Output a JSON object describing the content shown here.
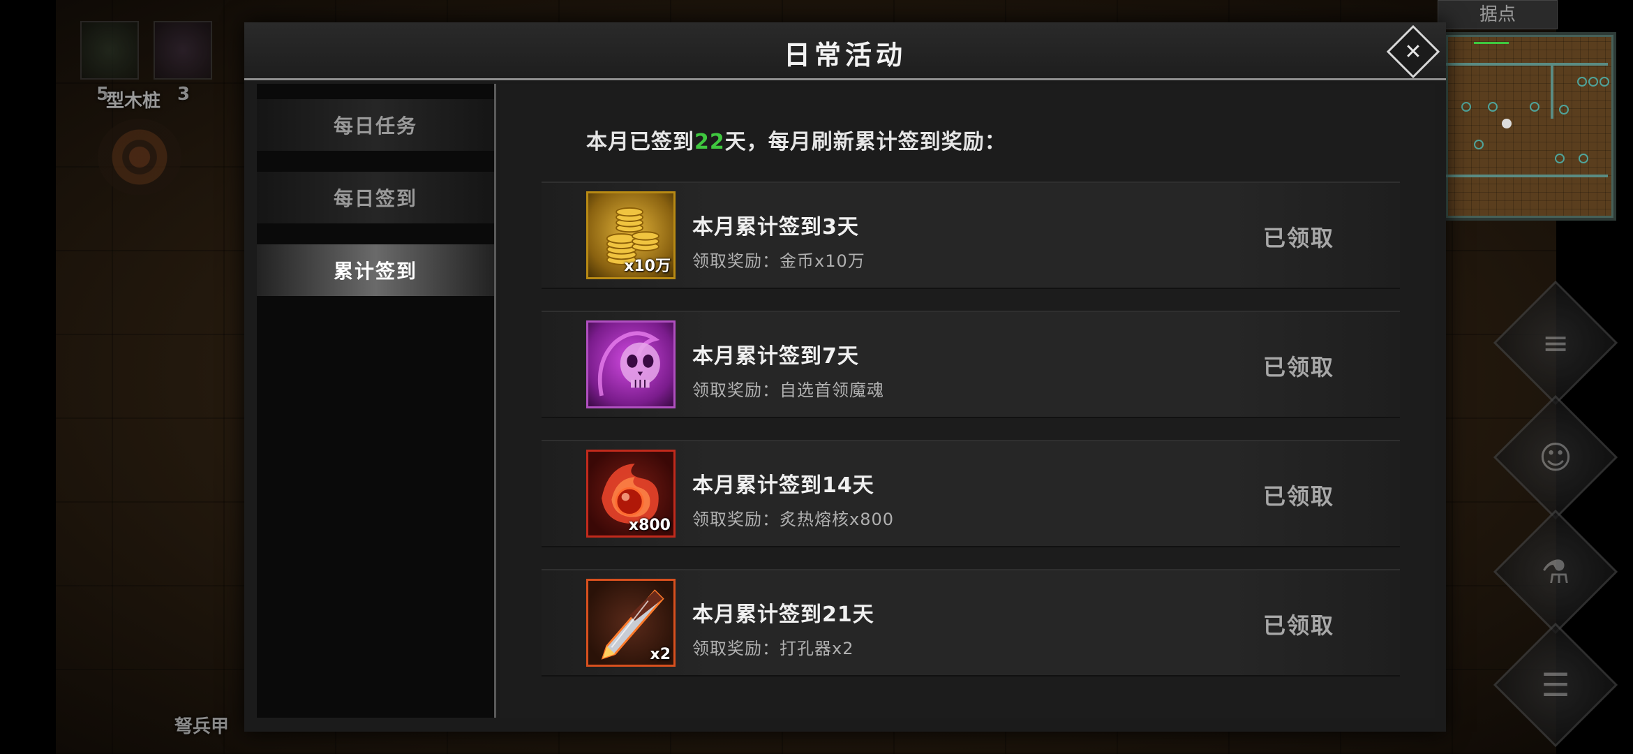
{
  "background": {
    "training_dummy_label": "型木桩",
    "dummy_prefix_numbers": "5",
    "dummy_suffix_number": "3",
    "crossbow_label": "弩兵甲",
    "minimap_title": "据点",
    "side_buttons": [
      "quest-scroll-icon",
      "friends-icon",
      "potion-icon",
      "menu-list-icon"
    ]
  },
  "dialog": {
    "title": "日常活动",
    "close_icon": "close-icon"
  },
  "tabs": [
    {
      "label": "每日任务",
      "active": false
    },
    {
      "label": "每日签到",
      "active": false
    },
    {
      "label": "累计签到",
      "active": true
    }
  ],
  "summary": {
    "prefix": "本月已签到",
    "days": "22",
    "suffix": "天，每月刷新累计签到奖励："
  },
  "rewards": [
    {
      "title": "本月累计签到3天",
      "reward": "领取奖励：金币x10万",
      "qty": "x10万",
      "status": "已领取",
      "icon": "gold-coins-icon",
      "frame_color": "#b88a14"
    },
    {
      "title": "本月累计签到7天",
      "reward": "领取奖励：自选首领魔魂",
      "qty": "",
      "status": "已领取",
      "icon": "purple-skull-soul-icon",
      "frame_color": "#b04fc0"
    },
    {
      "title": "本月累计签到14天",
      "reward": "领取奖励：炙热熔核x800",
      "qty": "x800",
      "status": "已领取",
      "icon": "fire-core-icon",
      "frame_color": "#c22a1c"
    },
    {
      "title": "本月累计签到21天",
      "reward": "领取奖励：打孔器x2",
      "qty": "x2",
      "status": "已领取",
      "icon": "socket-drill-icon",
      "frame_color": "#d8501e"
    }
  ],
  "colors": {
    "highlight_green": "#3fc73f",
    "active_tab_text": "#ffffff",
    "inactive_tab_text": "#9a9a9a"
  }
}
